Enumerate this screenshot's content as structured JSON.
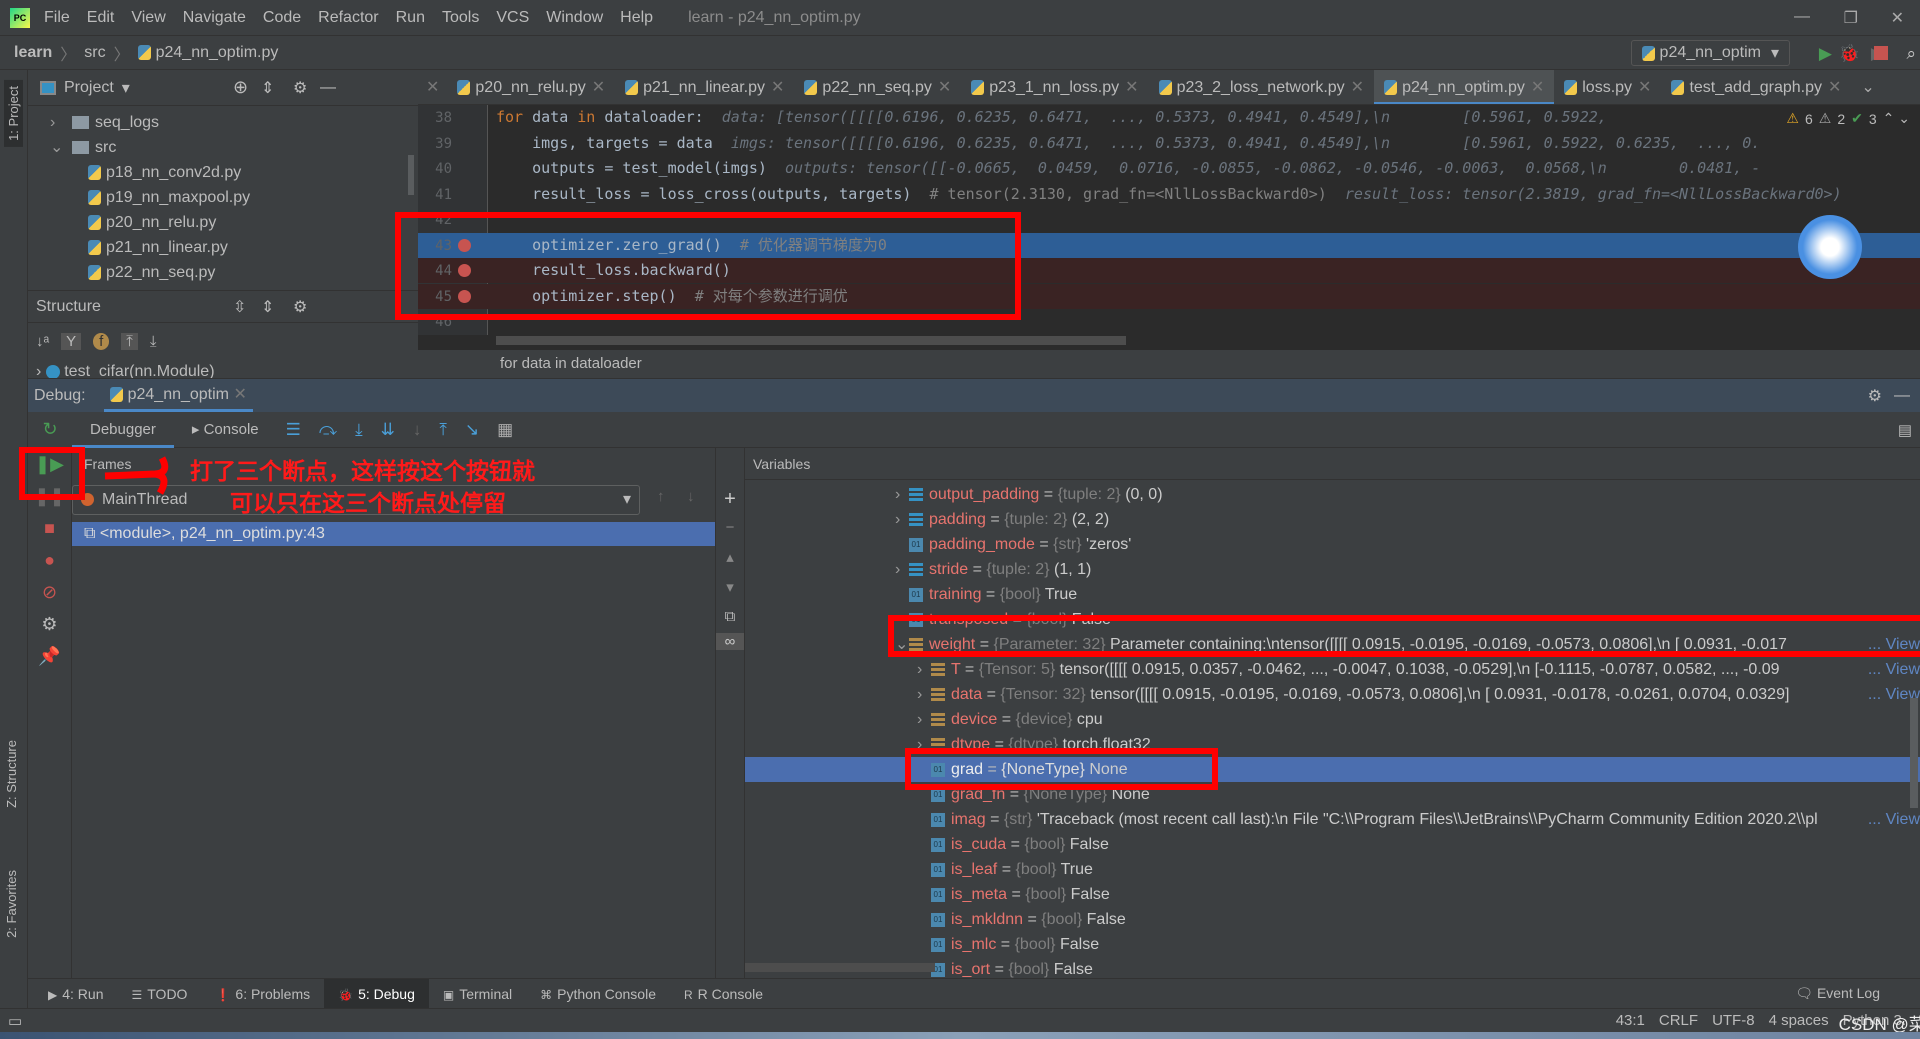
{
  "titlebar": {
    "menus": [
      "File",
      "Edit",
      "View",
      "Navigate",
      "Code",
      "Refactor",
      "Run",
      "Tools",
      "VCS",
      "Window",
      "Help"
    ],
    "title": "learn - p24_nn_optim.py"
  },
  "navbar": {
    "crumbs": [
      "learn",
      "src",
      "p24_nn_optim.py"
    ],
    "run_config": "p24_nn_optim"
  },
  "sidebar": {
    "project_tab": "1: Project",
    "structure_tab": "Z: Structure",
    "favorites_tab": "2: Favorites"
  },
  "project": {
    "title": "Project",
    "items": [
      {
        "label": "seq_logs",
        "type": "folder",
        "depth": 1,
        "expanded": false
      },
      {
        "label": "src",
        "type": "folder",
        "depth": 1,
        "expanded": true
      },
      {
        "label": "p18_nn_conv2d.py",
        "type": "py",
        "depth": 2
      },
      {
        "label": "p19_nn_maxpool.py",
        "type": "py",
        "depth": 2
      },
      {
        "label": "p20_nn_relu.py",
        "type": "py",
        "depth": 2
      },
      {
        "label": "p21_nn_linear.py",
        "type": "py",
        "depth": 2
      },
      {
        "label": "p22_nn_seq.py",
        "type": "py",
        "depth": 2
      }
    ]
  },
  "structure": {
    "title": "Structure",
    "item": "test_cifar(nn.Module)"
  },
  "editor": {
    "tabs": [
      {
        "label": "p20_nn_relu.py"
      },
      {
        "label": "p21_nn_linear.py"
      },
      {
        "label": "p22_nn_seq.py"
      },
      {
        "label": "p23_1_nn_loss.py"
      },
      {
        "label": "p23_2_loss_network.py"
      },
      {
        "label": "p24_nn_optim.py",
        "active": true
      },
      {
        "label": "loss.py"
      },
      {
        "label": "test_add_graph.py"
      }
    ],
    "inspections": {
      "warnings": "6",
      "weak_warnings": "2",
      "typos": "3"
    },
    "lines": [
      {
        "n": "38",
        "code": "for data in dataloader:",
        "hint": "data: [tensor([[[[0.6196, 0.6235, 0.6471,  ..., 0.5373, 0.4941, 0.4549],\\n        [0.5961, 0.5922,"
      },
      {
        "n": "39",
        "code": "    imgs, targets = data",
        "hint": "imgs: tensor([[[[0.6196, 0.6235, 0.6471,  ..., 0.5373, 0.4941, 0.4549],\\n        [0.5961, 0.5922, 0.6235,  ..., 0."
      },
      {
        "n": "40",
        "code": "    outputs = test_model(imgs)",
        "hint": "outputs: tensor([[-0.0665,  0.0459,  0.0716, -0.0855, -0.0862, -0.0546, -0.0063,  0.0568,\\n        0.0481, -"
      },
      {
        "n": "41",
        "code": "    result_loss = loss_cross(outputs, targets)",
        "comment": "# tensor(2.3130, grad_fn=<NllLossBackward0>)",
        "hint": "result_loss: tensor(2.3819, grad_fn=<NllLossBackward0>)"
      },
      {
        "n": "42",
        "code": ""
      },
      {
        "n": "43",
        "code": "    optimizer.zero_grad()",
        "comment": "# 优化器调节梯度为0",
        "breakpoint": true,
        "current": true
      },
      {
        "n": "44",
        "code": "    result_loss.backward()",
        "breakpoint": true
      },
      {
        "n": "45",
        "code": "    optimizer.step()",
        "comment": "# 对每个参数进行调优",
        "breakpoint": true
      },
      {
        "n": "46",
        "code": ""
      }
    ],
    "breadcrumb": "for data in dataloader"
  },
  "debug": {
    "label": "Debug:",
    "session": "p24_nn_optim",
    "tabs": [
      "Debugger",
      "Console"
    ],
    "frames_title": "Frames",
    "thread": "MainThread",
    "frame": "<module>, p24_nn_optim.py:43",
    "variables_title": "Variables",
    "variables": [
      {
        "name": "output_padding",
        "type": "{tuple: 2}",
        "value": "(0, 0)",
        "icon": "list",
        "depth": 0,
        "arrow": ">"
      },
      {
        "name": "padding",
        "type": "{tuple: 2}",
        "value": "(2, 2)",
        "icon": "list",
        "depth": 0,
        "arrow": ">"
      },
      {
        "name": "padding_mode",
        "type": "{str}",
        "value": "'zeros'",
        "icon": "str",
        "depth": 0
      },
      {
        "name": "stride",
        "type": "{tuple: 2}",
        "value": "(1, 1)",
        "icon": "list",
        "depth": 0,
        "arrow": ">"
      },
      {
        "name": "training",
        "type": "{bool}",
        "value": "True",
        "icon": "str",
        "depth": 0
      },
      {
        "name": "transposed",
        "type": "{bool}",
        "value": "False",
        "icon": "str",
        "depth": 0
      },
      {
        "name": "weight",
        "type": "{Parameter: 32}",
        "value": "Parameter containing:\\ntensor([[[[ 0.0915, -0.0195, -0.0169, -0.0573,  0.0806],\\n        [ 0.0931, -0.017",
        "icon": "obj",
        "depth": 0,
        "arrow": "v",
        "view": "... View"
      },
      {
        "name": "T",
        "type": "{Tensor: 5}",
        "value": "tensor([[[[ 0.0915,  0.0357, -0.0462,  ..., -0.0047,  0.1038, -0.0529],\\n        [-0.1115, -0.0787,  0.0582,  ..., -0.09",
        "icon": "obj",
        "depth": 1,
        "arrow": ">",
        "view": "... View"
      },
      {
        "name": "data",
        "type": "{Tensor: 32}",
        "value": "tensor([[[[ 0.0915, -0.0195, -0.0169, -0.0573,  0.0806],\\n        [ 0.0931, -0.0178, -0.0261,  0.0704,  0.0329]",
        "icon": "obj",
        "depth": 1,
        "arrow": ">",
        "view": "... View"
      },
      {
        "name": "device",
        "type": "{device}",
        "value": "cpu",
        "icon": "obj",
        "depth": 1,
        "arrow": ">"
      },
      {
        "name": "dtype",
        "type": "{dtype}",
        "value": "torch.float32",
        "icon": "obj",
        "depth": 1,
        "arrow": ">"
      },
      {
        "name": "grad",
        "type": "{NoneType}",
        "value": "None",
        "icon": "str",
        "depth": 1,
        "selected": true
      },
      {
        "name": "grad_fn",
        "type": "{NoneType}",
        "value": "None",
        "icon": "str",
        "depth": 1
      },
      {
        "name": "imag",
        "type": "{str}",
        "value": "'Traceback (most recent call last):\\n  File \"C:\\\\Program Files\\\\JetBrains\\\\PyCharm Community Edition 2020.2\\\\pl",
        "icon": "str",
        "depth": 1,
        "view": "... View"
      },
      {
        "name": "is_cuda",
        "type": "{bool}",
        "value": "False",
        "icon": "str",
        "depth": 1
      },
      {
        "name": "is_leaf",
        "type": "{bool}",
        "value": "True",
        "icon": "str",
        "depth": 1
      },
      {
        "name": "is_meta",
        "type": "{bool}",
        "value": "False",
        "icon": "str",
        "depth": 1
      },
      {
        "name": "is_mkldnn",
        "type": "{bool}",
        "value": "False",
        "icon": "str",
        "depth": 1
      },
      {
        "name": "is_mlc",
        "type": "{bool}",
        "value": "False",
        "icon": "str",
        "depth": 1
      },
      {
        "name": "is_ort",
        "type": "{bool}",
        "value": "False",
        "icon": "str",
        "depth": 1
      }
    ]
  },
  "annotation": {
    "line1": "打了三个断点，这样按这个按钮就",
    "line2": "可以只在这三个断点处停留",
    "color": "#ff0000"
  },
  "bottom_tabs": [
    {
      "label": "4: Run",
      "icon": "▶"
    },
    {
      "label": "TODO",
      "icon": "☰"
    },
    {
      "label": "6: Problems",
      "icon": "❗"
    },
    {
      "label": "5: Debug",
      "icon": "🐞",
      "active": true
    },
    {
      "label": "Terminal",
      "icon": "▣"
    },
    {
      "label": "Python Console",
      "icon": "⌘"
    },
    {
      "label": "R Console",
      "icon": "R"
    }
  ],
  "event_log": "Event Log",
  "status": {
    "position": "43:1",
    "line_sep": "CRLF",
    "encoding": "UTF-8",
    "indent": "4 spaces",
    "interpreter": "Python 3.",
    "watermark": "CSDN @菜菜子"
  },
  "colors": {
    "accent": "#4a88c7",
    "selection": "#4b6eaf",
    "breakpoint": "#c75450",
    "annotation": "#ff0000"
  }
}
